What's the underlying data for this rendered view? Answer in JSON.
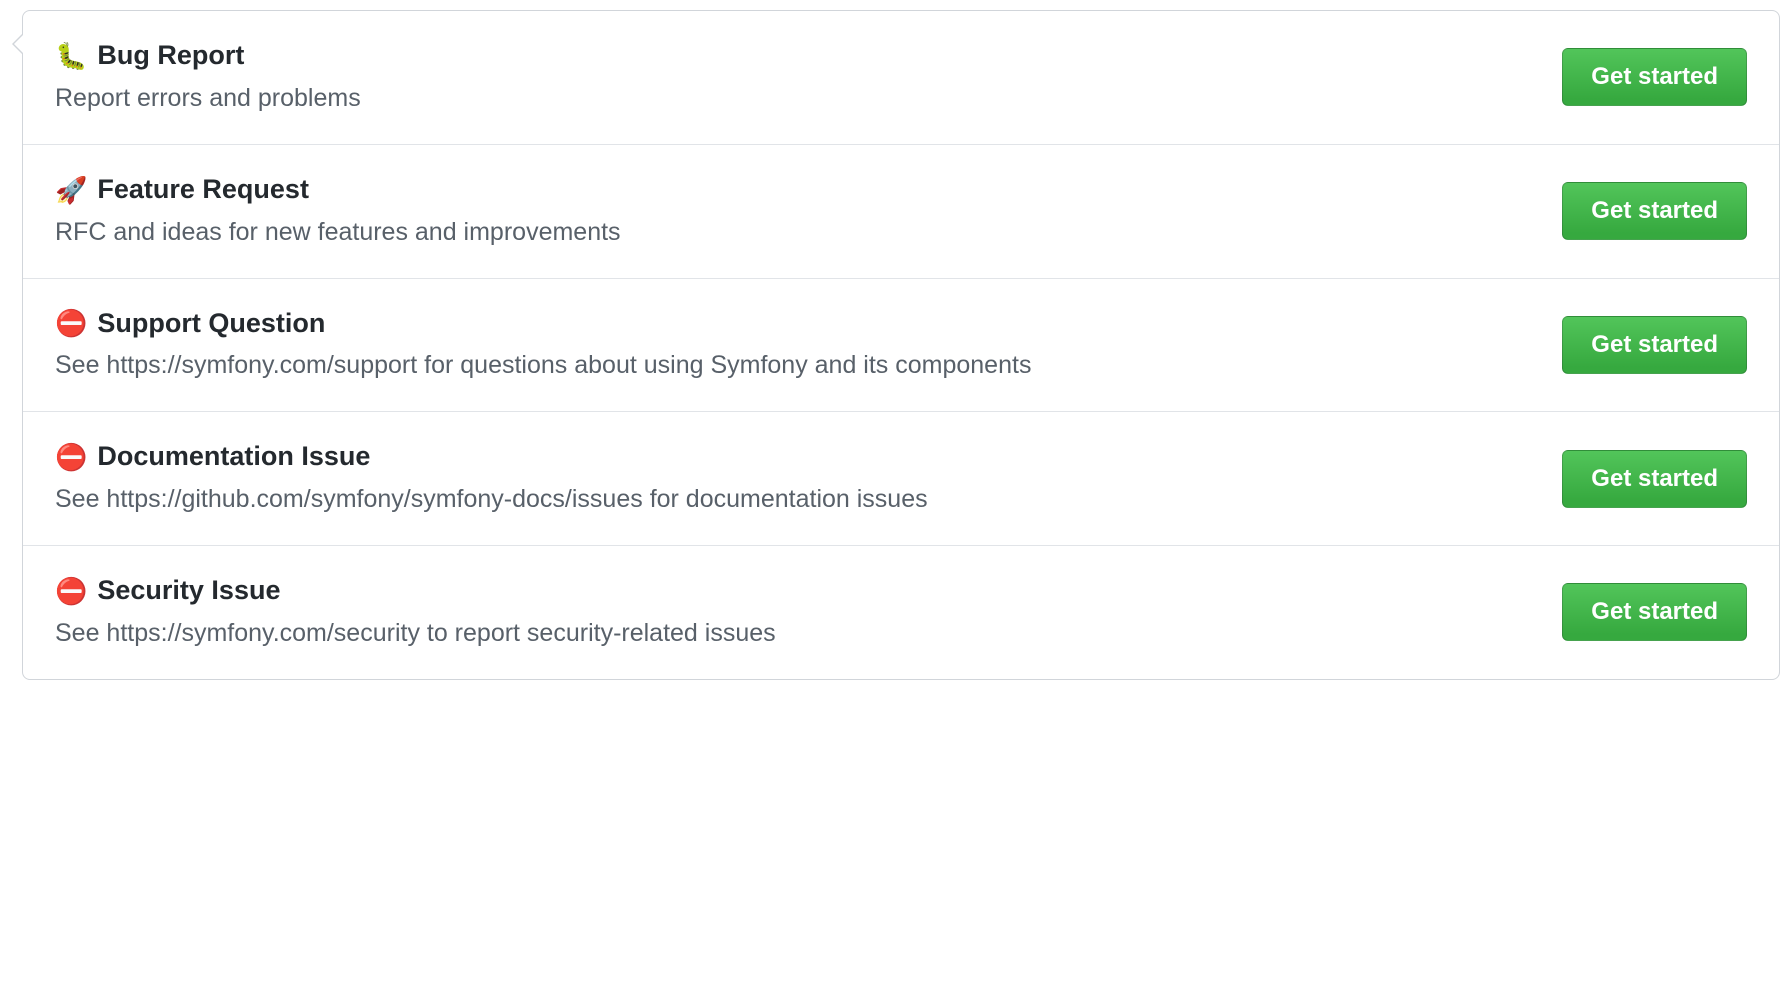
{
  "button_label": "Get started",
  "templates": [
    {
      "icon": "🐛",
      "title": "Bug Report",
      "desc": "Report errors and problems"
    },
    {
      "icon": "🚀",
      "title": "Feature Request",
      "desc": "RFC and ideas for new features and improvements"
    },
    {
      "icon": "⛔",
      "title": "Support Question",
      "desc": "See https://symfony.com/support for questions about using Symfony and its components"
    },
    {
      "icon": "⛔",
      "title": "Documentation Issue",
      "desc": "See https://github.com/symfony/symfony-docs/issues for documentation issues"
    },
    {
      "icon": "⛔",
      "title": "Security Issue",
      "desc": "See https://symfony.com/security to report security-related issues"
    }
  ]
}
